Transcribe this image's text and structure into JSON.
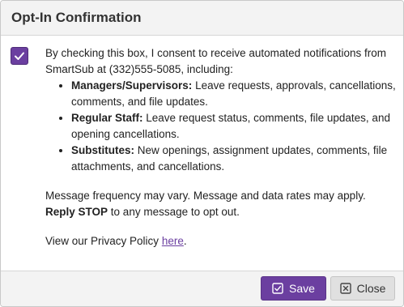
{
  "dialog": {
    "title": "Opt-In Confirmation",
    "checkbox_checked": true,
    "consent_intro": "By checking this box, I consent to receive automated notifications from SmartSub at (332)555-5085, including:",
    "roles": [
      {
        "name": "Managers/Supervisors:",
        "description": "Leave requests, approvals, cancellations, comments, and file updates."
      },
      {
        "name": "Regular Staff:",
        "description": "Leave request status, comments, file updates, and opening cancellations."
      },
      {
        "name": "Substitutes:",
        "description": "New openings, assignment updates, comments, file attachments, and cancellations."
      }
    ],
    "frequency_text": "Message frequency may vary. Message and data rates may apply.",
    "reply_stop_bold": "Reply STOP",
    "reply_stop_rest": "to any message to opt out.",
    "privacy_prefix": "View our Privacy Policy",
    "privacy_link": "here",
    "privacy_suffix": "."
  },
  "footer": {
    "save_label": "Save",
    "close_label": "Close"
  },
  "icons": {
    "checkbox": "check-icon",
    "save": "check-square-icon",
    "close": "x-square-icon"
  },
  "colors": {
    "accent": "#6b3fa0",
    "header_bg": "#f3f3f3",
    "close_button_bg": "#e0e0e0"
  }
}
